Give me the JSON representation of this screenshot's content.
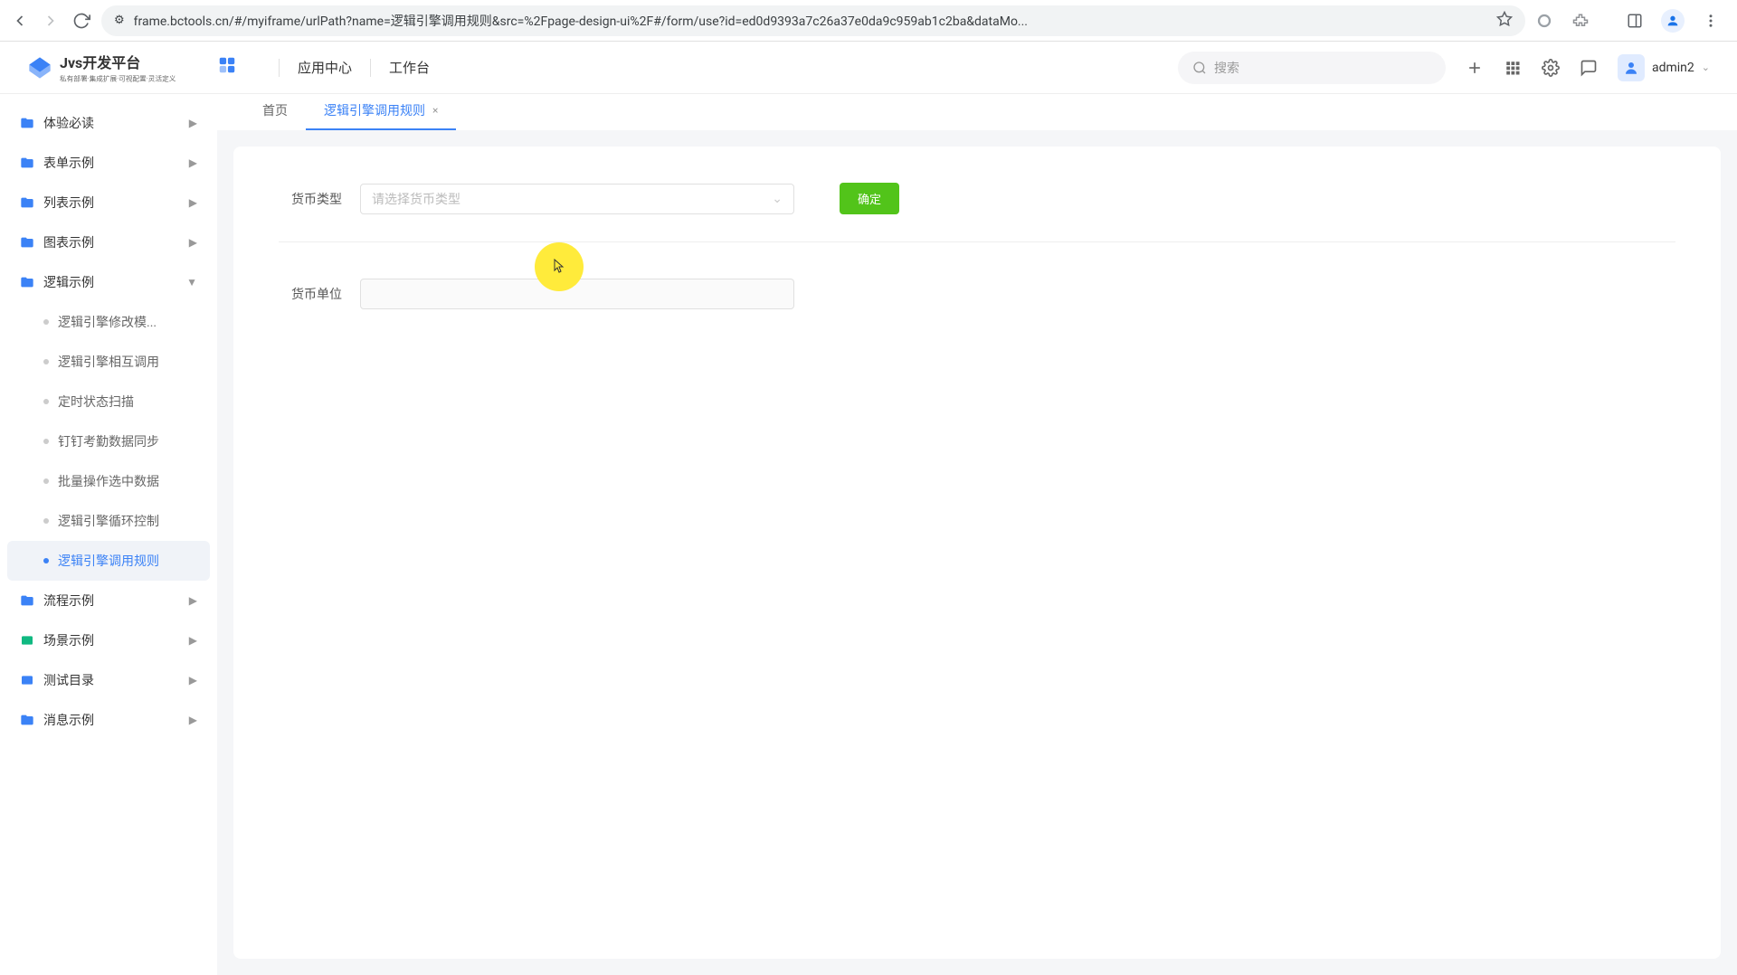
{
  "browser": {
    "url": "frame.bctools.cn/#/myiframe/urlPath?name=逻辑引擎调用规则&src=%2Fpage-design-ui%2F#/form/use?id=ed0d9393a7c26a37e0da9c959ab1c2ba&dataMo..."
  },
  "header": {
    "logo_title": "Jvs开发平台",
    "logo_subtitle": "私有部署·集成扩展·可视配置·灵活定义",
    "nav_app_center": "应用中心",
    "nav_workspace": "工作台",
    "search_placeholder": "搜索",
    "username": "admin2"
  },
  "sidebar": {
    "items": [
      {
        "label": "体验必读",
        "icon": "folder-blue",
        "expanded": false
      },
      {
        "label": "表单示例",
        "icon": "folder-blue",
        "expanded": false
      },
      {
        "label": "列表示例",
        "icon": "folder-blue",
        "expanded": false
      },
      {
        "label": "图表示例",
        "icon": "folder-blue",
        "expanded": false
      },
      {
        "label": "逻辑示例",
        "icon": "folder-blue",
        "expanded": true
      },
      {
        "label": "流程示例",
        "icon": "folder-blue",
        "expanded": false
      },
      {
        "label": "场景示例",
        "icon": "folder-teal",
        "expanded": false
      },
      {
        "label": "测试目录",
        "icon": "folder-blue",
        "expanded": false
      },
      {
        "label": "消息示例",
        "icon": "folder-blue",
        "expanded": false
      }
    ],
    "subitems": [
      {
        "label": "逻辑引擎修改模...",
        "active": false
      },
      {
        "label": "逻辑引擎相互调用",
        "active": false
      },
      {
        "label": "定时状态扫描",
        "active": false
      },
      {
        "label": "钉钉考勤数据同步",
        "active": false
      },
      {
        "label": "批量操作选中数据",
        "active": false
      },
      {
        "label": "逻辑引擎循环控制",
        "active": false
      },
      {
        "label": "逻辑引擎调用规则",
        "active": true
      }
    ]
  },
  "tabs": [
    {
      "label": "首页",
      "active": false,
      "closable": false
    },
    {
      "label": "逻辑引擎调用规则",
      "active": true,
      "closable": true
    }
  ],
  "form": {
    "currency_type_label": "货币类型",
    "currency_type_placeholder": "请选择货币类型",
    "confirm_button": "确定",
    "currency_unit_label": "货币单位"
  }
}
